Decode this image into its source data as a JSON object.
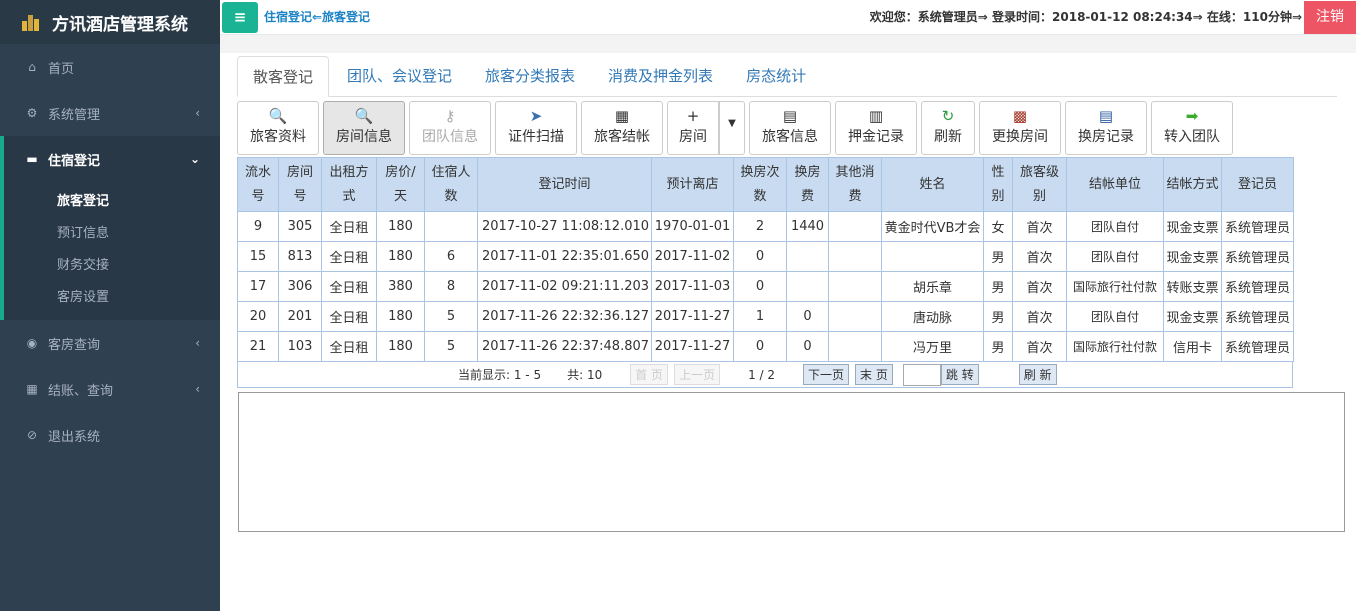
{
  "app": {
    "title": "方讯酒店管理系统"
  },
  "sidebar": {
    "items": [
      {
        "label": "首页",
        "icon": "home-icon"
      },
      {
        "label": "系统管理",
        "icon": "gear-icon"
      },
      {
        "label": "住宿登记",
        "icon": "bed-icon"
      },
      {
        "label": "客房查询",
        "icon": "eye-icon"
      },
      {
        "label": "结账、查询",
        "icon": "calculator-icon"
      },
      {
        "label": "退出系统",
        "icon": "ban-icon"
      }
    ],
    "sub_items": [
      "旅客登记",
      "预订信息",
      "财务交接",
      "客房设置"
    ]
  },
  "topbar": {
    "breadcrumb": "住宿登记⇐旅客登记",
    "welcome": "欢迎您：系统管理员⇒ 登录时间：2018-01-12 08:24:34⇒ 在线：110分钟⇒",
    "logout": "注销"
  },
  "tabs": [
    "散客登记",
    "团队、会议登记",
    "旅客分类报表",
    "消费及押金列表",
    "房态统计"
  ],
  "toolbar": [
    "旅客资料",
    "房间信息",
    "团队信息",
    "证件扫描",
    "旅客结帐",
    "房间",
    "旅客信息",
    "押金记录",
    "刷新",
    "更换房间",
    "换房记录",
    "转入团队"
  ],
  "table": {
    "headers": [
      "流水号",
      "房间号",
      "出租方式",
      "房价/天",
      "住宿人数",
      "登记时间",
      "预计离店",
      "换房次数",
      "换房费",
      "其他消费",
      "姓名",
      "性别",
      "旅客级别",
      "结帐单位",
      "结帐方式",
      "登记员"
    ],
    "rows": [
      [
        "9",
        "305",
        "全日租",
        "180",
        "",
        "2017-10-27 11:08:12.010",
        "1970-01-01",
        "2",
        "1440",
        "",
        "黄金时代VB才会",
        "女",
        "首次",
        "团队自付",
        "现金支票",
        "系统管理员"
      ],
      [
        "15",
        "813",
        "全日租",
        "180",
        "6",
        "2017-11-01 22:35:01.650",
        "2017-11-02",
        "0",
        "",
        "",
        "",
        "男",
        "首次",
        "团队自付",
        "现金支票",
        "系统管理员"
      ],
      [
        "17",
        "306",
        "全日租",
        "380",
        "8",
        "2017-11-02 09:21:11.203",
        "2017-11-03",
        "0",
        "",
        "",
        "胡乐章",
        "男",
        "首次",
        "国际旅行社付款",
        "转账支票",
        "系统管理员"
      ],
      [
        "20",
        "201",
        "全日租",
        "180",
        "5",
        "2017-11-26 22:32:36.127",
        "2017-11-27",
        "1",
        "0",
        "",
        "唐动脉",
        "男",
        "首次",
        "团队自付",
        "现金支票",
        "系统管理员"
      ],
      [
        "21",
        "103",
        "全日租",
        "180",
        "5",
        "2017-11-26 22:37:48.807",
        "2017-11-27",
        "0",
        "0",
        "",
        "冯万里",
        "男",
        "首次",
        "国际旅行社付款",
        "信用卡",
        "系统管理员"
      ]
    ]
  },
  "pager": {
    "showing": "当前显示: 1 - 5",
    "total": "共: 10",
    "first": "首 页",
    "prev": "上一页",
    "page": "1 / 2",
    "next": "下一页",
    "last": "末 页",
    "jump": "跳 转",
    "refresh": "刷 新"
  }
}
